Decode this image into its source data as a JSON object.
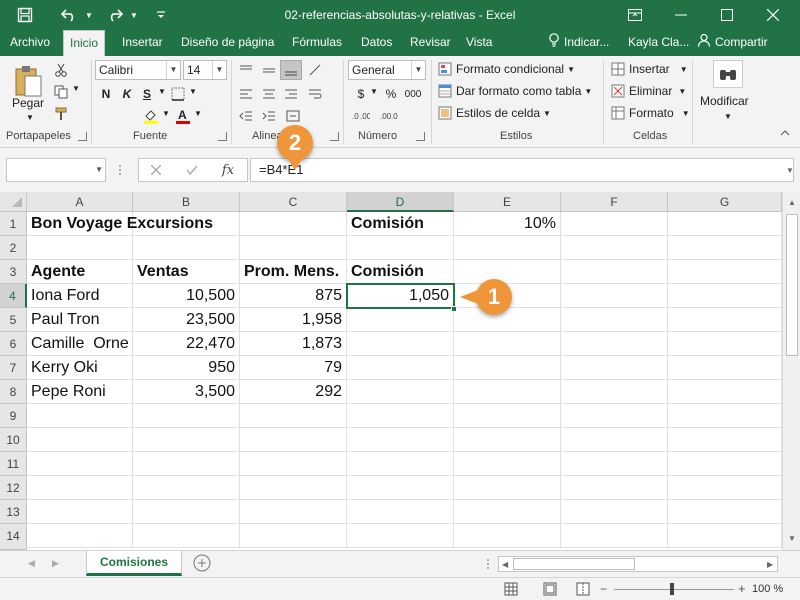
{
  "app": {
    "window_title": "02-referencias-absolutas-y-relativas - Excel",
    "user": "Kayla Cla...",
    "share_label": "Compartir",
    "tellme_label": "Indicar..."
  },
  "menu": {
    "tabs": [
      "Archivo",
      "Inicio",
      "Insertar",
      "Diseño de página",
      "Fórmulas",
      "Datos",
      "Revisar",
      "Vista"
    ]
  },
  "ribbon": {
    "clipboard": {
      "paste": "Pegar",
      "group": "Portapapeles"
    },
    "font": {
      "name": "Calibri",
      "size": "14",
      "bold": "N",
      "italic": "K",
      "underline": "S",
      "group": "Fuente"
    },
    "alignment": {
      "group": "Alineación"
    },
    "number": {
      "format": "General",
      "currency": "$",
      "percent": "%",
      "thousands": "000",
      "group": "Número"
    },
    "styles": {
      "conditional": "Formato condicional",
      "as_table": "Dar formato como tabla",
      "cell_styles": "Estilos de celda",
      "group": "Estilos"
    },
    "cells": {
      "insert": "Insertar",
      "delete": "Eliminar",
      "format": "Formato",
      "group": "Celdas"
    },
    "editing": {
      "modify": "Modificar"
    }
  },
  "formula_bar": {
    "name_box": "",
    "fx": "fx",
    "formula": "=B4*E1"
  },
  "sheet": {
    "columns": [
      "A",
      "B",
      "C",
      "D",
      "E",
      "F",
      "G"
    ],
    "rows": [
      "1",
      "2",
      "3",
      "4",
      "5",
      "6",
      "7",
      "8",
      "9",
      "10",
      "11",
      "12",
      "13",
      "14"
    ],
    "cells": {
      "A1": "Bon Voyage Excursions",
      "D1": "Comisión",
      "E1": "10%",
      "A3": "Agente",
      "B3": "Ventas",
      "C3": "Prom. Mens.",
      "D3": "Comisión",
      "A4": "Iona Ford",
      "B4": "10,500",
      "C4": "875",
      "D4": "1,050",
      "A5": "Paul Tron",
      "B5": "23,500",
      "C5": "1,958",
      "A6": "Camille  Orne",
      "B6": "22,470",
      "C6": "1,873",
      "A7": "Kerry Oki",
      "B7": "950",
      "C7": "79",
      "A8": "Pepe Roni",
      "B8": "3,500",
      "C8": "292"
    },
    "active_cell": "D4",
    "tab_name": "Comisiones"
  },
  "callouts": {
    "one": "1",
    "two": "2"
  },
  "status": {
    "zoom": "100 %"
  },
  "colors": {
    "excel_green": "#217346",
    "callout_orange": "#f0963a"
  }
}
